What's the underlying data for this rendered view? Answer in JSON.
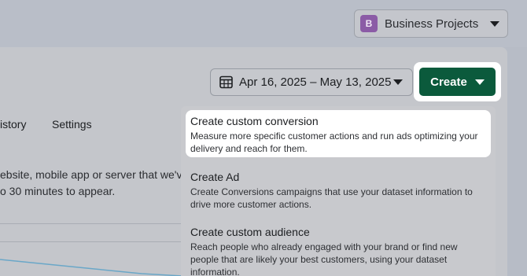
{
  "account": {
    "initial": "B",
    "name": "Business Projects"
  },
  "toolbar": {
    "date_range": "Apr 16, 2025 – May 13, 2025",
    "create_label": "Create"
  },
  "tabs": {
    "history": "istory",
    "settings": "Settings"
  },
  "description": {
    "line1": "ebsite, mobile app or server that we'v",
    "line2": "o 30 minutes to appear."
  },
  "menu": {
    "items": [
      {
        "title": "Create custom conversion",
        "desc": "Measure more specific customer actions and run ads optimizing your delivery and reach for them."
      },
      {
        "title": "Create Ad",
        "desc": "Create Conversions campaigns that use your dataset information to drive more customer actions."
      },
      {
        "title": "Create custom audience",
        "desc": "Reach people who already engaged with your brand or find new people that are likely your best customers, using your dataset information."
      }
    ]
  }
}
